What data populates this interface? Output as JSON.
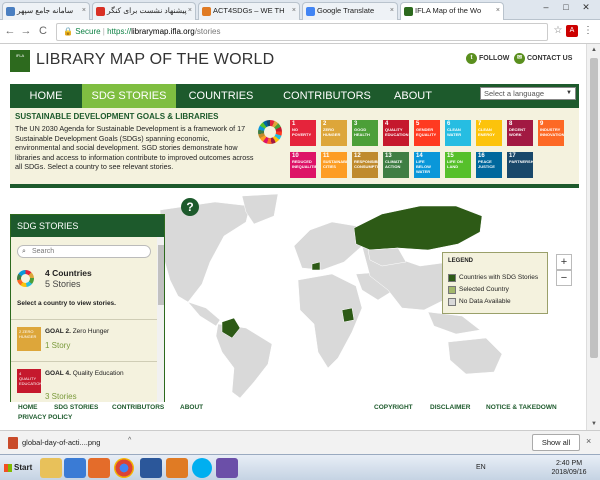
{
  "browser": {
    "tabs": [
      {
        "title": "سامانه جامع سپهر",
        "fav": "#4a7fc1",
        "active": false
      },
      {
        "title": "پیشنهاد نشست برای کنگر",
        "fav": "#d93025",
        "active": false
      },
      {
        "title": "ACT4SDGs – WE TH",
        "fav": "#e07b24",
        "active": false
      },
      {
        "title": "Google Translate",
        "fav": "#4285f4",
        "active": false
      },
      {
        "title": "IFLA Map of the Wo",
        "fav": "#2d6a1e",
        "active": true
      }
    ],
    "close_glyph": "×",
    "controls": {
      "min": "–",
      "max": "□",
      "close": "✕"
    },
    "back": "←",
    "forward": "→",
    "reload": "C",
    "secure_label": "Secure",
    "url_scheme": "https://",
    "url_host": "librarymap.ifla.org",
    "url_path": "/stories",
    "star": "☆",
    "menu": "⋮"
  },
  "site": {
    "logo_text": "IFLA",
    "title": "LIBRARY MAP OF THE WORLD",
    "follow": "FOLLOW",
    "contact": "CONTACT US"
  },
  "nav": {
    "items": [
      {
        "label": "HOME",
        "active": false
      },
      {
        "label": "SDG STORIES",
        "active": true
      },
      {
        "label": "COUNTRIES",
        "active": false
      },
      {
        "label": "CONTRIBUTORS",
        "active": false
      },
      {
        "label": "ABOUT",
        "active": false
      }
    ],
    "language_placeholder": "Select a language"
  },
  "sdg": {
    "heading": "SUSTAINABLE DEVELOPMENT GOALS & LIBRARIES",
    "description": "The UN 2030 Agenda for Sustainable Development is a framework of 17 Sustainable Development Goals (SDGs) spanning economic, environmental and social development. SGD stories demonstrate how libraries and access to information contribute to improved outcomes across all SDGs. Select a country to see relevant stories.",
    "goals": [
      {
        "n": "1",
        "label": "NO POVERTY",
        "color": "#e5243b"
      },
      {
        "n": "2",
        "label": "ZERO HUNGER",
        "color": "#dda63a"
      },
      {
        "n": "3",
        "label": "GOOD HEALTH",
        "color": "#4c9f38"
      },
      {
        "n": "4",
        "label": "QUALITY EDUCATION",
        "color": "#c5192d"
      },
      {
        "n": "5",
        "label": "GENDER EQUALITY",
        "color": "#ff3a21"
      },
      {
        "n": "6",
        "label": "CLEAN WATER",
        "color": "#26bde2"
      },
      {
        "n": "7",
        "label": "CLEAN ENERGY",
        "color": "#fcc30b"
      },
      {
        "n": "8",
        "label": "DECENT WORK",
        "color": "#a21942"
      },
      {
        "n": "9",
        "label": "INDUSTRY INNOVATION",
        "color": "#fd6925"
      },
      {
        "n": "10",
        "label": "REDUCED INEQUALITIES",
        "color": "#dd1367"
      },
      {
        "n": "11",
        "label": "SUSTAINABLE CITIES",
        "color": "#fd9d24"
      },
      {
        "n": "12",
        "label": "RESPONSIBLE CONSUMPTION",
        "color": "#bf8b2e"
      },
      {
        "n": "13",
        "label": "CLIMATE ACTION",
        "color": "#3f7e44"
      },
      {
        "n": "14",
        "label": "LIFE BELOW WATER",
        "color": "#0a97d9"
      },
      {
        "n": "15",
        "label": "LIFE ON LAND",
        "color": "#56c02b"
      },
      {
        "n": "16",
        "label": "PEACE JUSTICE",
        "color": "#00689d"
      },
      {
        "n": "17",
        "label": "PARTNERSHIPS",
        "color": "#19486a"
      }
    ]
  },
  "panel": {
    "title": "SDG STORIES",
    "search_placeholder": "Search",
    "countries": "4 Countries",
    "stories": "5 Stories",
    "prompt": "Select a country to view stories.",
    "items": [
      {
        "goal": "GOAL 2.",
        "name": "Zero Hunger",
        "count": "1 Story",
        "color": "#dda63a",
        "icon_text": "2 ZERO HUNGER"
      },
      {
        "goal": "GOAL 4.",
        "name": "Quality Education",
        "count": "3 Stories",
        "color": "#c5192d",
        "icon_text": "4 QUALITY EDUCATION"
      }
    ]
  },
  "map": {
    "help": "?",
    "zoom_in": "+",
    "zoom_out": "−",
    "legend_title": "LEGEND",
    "legend": [
      {
        "label": "Countries with SDG Stories",
        "color": "#2d5a16"
      },
      {
        "label": "Selected Country",
        "color": "#a3b86b"
      },
      {
        "label": "No Data Available",
        "color": "#d9d9d9"
      }
    ]
  },
  "footer": {
    "left": [
      "HOME",
      "SDG STORIES",
      "CONTRIBUTORS",
      "ABOUT"
    ],
    "privacy": "PRIVACY POLICY",
    "right": [
      "COPYRIGHT",
      "DISCLAIMER",
      "NOTICE & TAKEDOWN"
    ]
  },
  "download": {
    "filename": "global-day-of-acti....png",
    "show_all": "Show all"
  },
  "taskbar": {
    "start": "Start",
    "lang": "EN",
    "time": "2:40 PM",
    "date": "2018/09/16"
  }
}
